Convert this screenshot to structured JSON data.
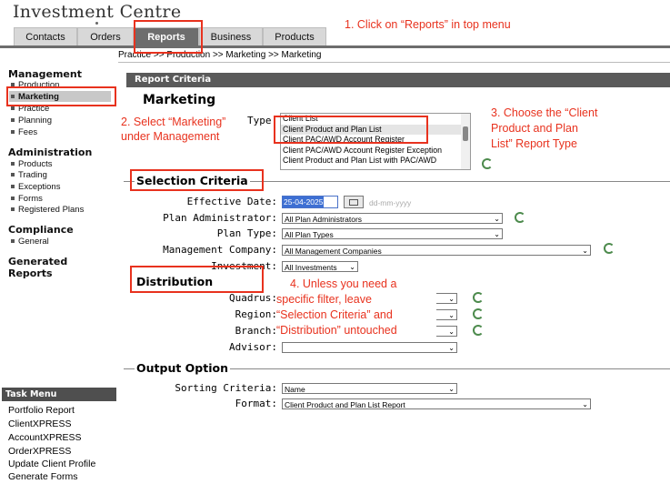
{
  "app": {
    "title": "Investment Centre"
  },
  "top_tabs": [
    "Contacts",
    "Orders",
    "Reports",
    "Business",
    "Products"
  ],
  "breadcrumb": "Practice >> Production >> Marketing >> Marketing",
  "sidebar": {
    "sections": [
      {
        "title": "Management",
        "items": [
          "Production",
          "Marketing",
          "Practice",
          "Planning",
          "Fees"
        ]
      },
      {
        "title": "Administration",
        "items": [
          "Products",
          "Trading",
          "Exceptions",
          "Forms",
          "Registered Plans"
        ]
      },
      {
        "title": "Compliance",
        "items": [
          "General"
        ]
      },
      {
        "title": "Generated Reports",
        "items": []
      }
    ],
    "selected": "Marketing"
  },
  "task_menu": {
    "title": "Task Menu",
    "items": [
      "Portfolio Report",
      "ClientXPRESS",
      "AccountXPRESS",
      "OrderXPRESS",
      "Update Client Profile",
      "Generate Forms"
    ]
  },
  "report_criteria": {
    "header": "Report Criteria",
    "title": "Marketing",
    "type_label": "Type",
    "type_options": [
      "Client List",
      "Client Product and Plan List",
      "Client PAC/AWD Account Register",
      "Client PAC/AWD Account Register Exception",
      "Client Product and Plan List with PAC/AWD"
    ],
    "type_selected": "Client Product and Plan List"
  },
  "selection_criteria": {
    "legend": "Selection Criteria",
    "effective_date_label": "Effective Date:",
    "effective_date_value": "25-04-2025",
    "date_format_hint": "dd-mm-yyyy",
    "plan_admin_label": "Plan Administrator:",
    "plan_admin_value": "All Plan Administrators",
    "plan_type_label": "Plan Type:",
    "plan_type_value": "All Plan Types",
    "mgmt_company_label": "Management Company:",
    "mgmt_company_value": "All Management Companies",
    "investment_label": "Investment:",
    "investment_value": "All Investments"
  },
  "distribution": {
    "legend": "Distribution",
    "quadrus_label": "Quadrus:",
    "region_label": "Region:",
    "branch_label": "Branch:",
    "advisor_label": "Advisor:"
  },
  "output_option": {
    "legend": "Output Option",
    "sorting_label": "Sorting Criteria:",
    "sorting_value": "Name",
    "format_label": "Format:",
    "format_value": "Client Product and Plan List Report"
  },
  "annotations": {
    "step1": "1. Click on “Reports” in top menu",
    "step2_line1": "2. Select “Marketing”",
    "step2_line2": "under Management",
    "step3_line1": "3. Choose the “Client",
    "step3_line2": "Product and Plan",
    "step3_line3": "List” Report Type",
    "step4_line1": "4. Unless you need a",
    "step4_line2": "specific filter, leave",
    "step4_line3": "“Selection Criteria” and",
    "step4_line4": "“Distribution” untouched"
  },
  "colors": {
    "annotation_red": "#e8321e",
    "header_gray": "#5a5a5a",
    "active_tab": "#6d6d6d"
  }
}
